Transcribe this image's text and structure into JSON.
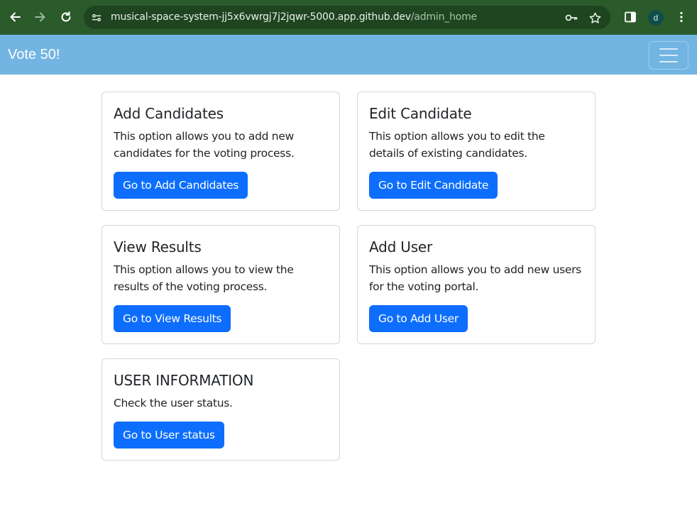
{
  "browser": {
    "url_host": "musical-space-system-jj5x6vwrgj7j2jqwr-5000.app.github.dev",
    "url_path": "/admin_home",
    "profile_initial": "d",
    "icons": [
      "back-icon",
      "forward-icon",
      "reload-icon",
      "site-info-icon",
      "key-icon",
      "star-icon",
      "side-panel-icon",
      "more-icon"
    ]
  },
  "navbar": {
    "brand": "Vote 50!",
    "toggler_icon": "hamburger-icon"
  },
  "cards": [
    {
      "title": "Add Candidates",
      "text": "This option allows you to add new candidates for the voting process.",
      "button": "Go to Add Candidates"
    },
    {
      "title": "Edit Candidate",
      "text": "This option allows you to edit the details of existing candidates.",
      "button": "Go to Edit Candidate"
    },
    {
      "title": "View Results",
      "text": "This option allows you to view the results of the voting process.",
      "button": "Go to View Results"
    },
    {
      "title": "Add User",
      "text": "This option allows you to add new users for the voting portal.",
      "button": "Go to Add User"
    },
    {
      "title": "USER INFORMATION",
      "text": "Check the user status.",
      "button": "Go to User status"
    }
  ],
  "colors": {
    "browser_bar": "#2b5a2b",
    "navbar": "#72b4e2",
    "button": "#0d6efd"
  }
}
